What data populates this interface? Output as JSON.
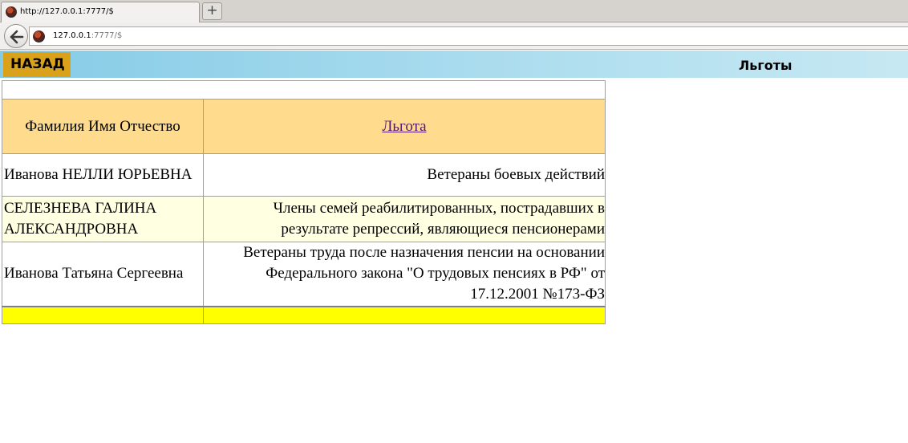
{
  "browser": {
    "tab_title": "http://127.0.0.1:7777/$",
    "new_tab_label": "+",
    "url_host": "127.0.0.1",
    "url_rest": ":7777/$"
  },
  "header": {
    "back_label": "НАЗАД",
    "title": "Льготы"
  },
  "table": {
    "col_name": "Фамилия Имя Отчество",
    "col_benefit": "Льгота",
    "rows": [
      {
        "name": "Иванова НЕЛЛИ ЮРЬЕВНА",
        "benefit": "Ветераны боевых действий"
      },
      {
        "name": "СЕЛЕЗНЕВА ГАЛИНА АЛЕКСАНДРОВНА",
        "benefit": "Члены семей реабилитированных, пострадавших в результате репрессий, являющиеся пенсионерами"
      },
      {
        "name": "Иванова Татьяна Сергеевна",
        "benefit": "Ветераны труда после назначения пенсии на основании Федерального закона \"О трудовых пенсиях в РФ\" от 17.12.2001 №173-ФЗ"
      }
    ]
  },
  "colors": {
    "header_row": "#fedb8d",
    "alt_row": "#ffffe1",
    "footer_row": "#ffff00",
    "back_button": "#d9a21a"
  },
  "icons": {
    "favicon": "globe-favicon-icon",
    "back": "arrow-left-icon"
  }
}
